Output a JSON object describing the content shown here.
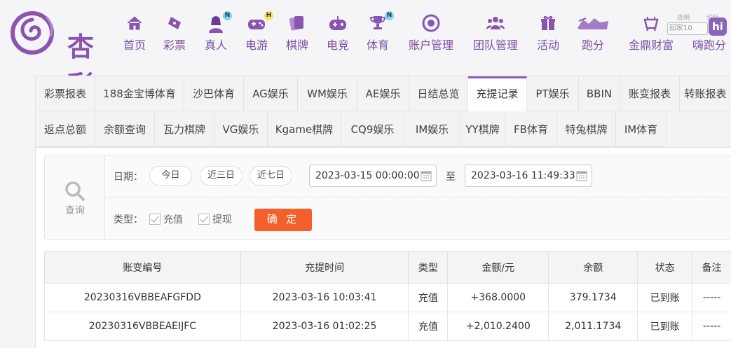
{
  "brand": {
    "logo_text": "杏彩",
    "accent": "#8a54b2"
  },
  "nav": [
    {
      "label": "首页",
      "icon": "home-icon",
      "badge": ""
    },
    {
      "label": "彩票",
      "icon": "lottery-ticket-icon",
      "badge": ""
    },
    {
      "label": "真人",
      "icon": "live-dealer-icon",
      "badge": "N"
    },
    {
      "label": "电游",
      "icon": "gamepad-icon",
      "badge": "H"
    },
    {
      "label": "棋牌",
      "icon": "cards-icon",
      "badge": ""
    },
    {
      "label": "电竞",
      "icon": "esports-controller-icon",
      "badge": ""
    },
    {
      "label": "体育",
      "icon": "trophy-icon",
      "badge": "N"
    },
    {
      "label": "账户管理",
      "icon": "account-icon",
      "badge": ""
    },
    {
      "label": "团队管理",
      "icon": "team-icon",
      "badge": ""
    },
    {
      "label": "活动",
      "icon": "gift-icon",
      "badge": ""
    },
    {
      "label": "跑分",
      "icon": "running-score-icon",
      "badge": ""
    },
    {
      "label": "金鼎财富",
      "icon": "wealth-icon",
      "badge": ""
    },
    {
      "label": "嗨跑分",
      "icon": "hi-running-icon",
      "badge": ""
    }
  ],
  "watermark": {
    "top_left": "查明",
    "top_right": "论坛",
    "box": "回家10",
    "hi": "hi"
  },
  "tabs_row1": [
    "彩票报表",
    "188金宝博体育",
    "沙巴体育",
    "AG娱乐",
    "WM娱乐",
    "AE娱乐",
    "日结总览",
    "充提记录",
    "PT娱乐",
    "BBIN",
    "账变报表",
    "转账报表"
  ],
  "tabs_row2": [
    "返点总额",
    "余额查询",
    "瓦力棋牌",
    "VG娱乐",
    "Kgame棋牌",
    "CQ9娱乐",
    "IM娱乐",
    "YY棋牌",
    "FB体育",
    "特兔棋牌",
    "IM体育"
  ],
  "active_tab": "充提记录",
  "filter": {
    "side_label": "查询",
    "date_label": "日期：",
    "quick_dates": [
      "今日",
      "近三日",
      "近七日"
    ],
    "start_date": "2023-03-15 00:00:00",
    "end_date": "2023-03-16 11:49:33",
    "to_label": "至",
    "type_label": "类型：",
    "types": [
      "充值",
      "提现"
    ],
    "confirm_label": "确 定"
  },
  "table": {
    "headers": [
      "账变编号",
      "充提时间",
      "类型",
      "金额/元",
      "余额",
      "状态",
      "备注"
    ],
    "rows": [
      [
        "20230316VBBEAFGFDD",
        "2023-03-16 10:03:41",
        "充值",
        "+368.0000",
        "379.1734",
        "已到账",
        "-----"
      ],
      [
        "20230316VBBEAEIJFC",
        "2023-03-16 01:02:25",
        "充值",
        "+2,010.2400",
        "2,011.1734",
        "已到账",
        "-----"
      ]
    ]
  },
  "colors": {
    "amount": "#e0302a",
    "status_ok": "#2e9a2e",
    "confirm": "#f4602b",
    "tab_active_border": "#8b5db5"
  }
}
